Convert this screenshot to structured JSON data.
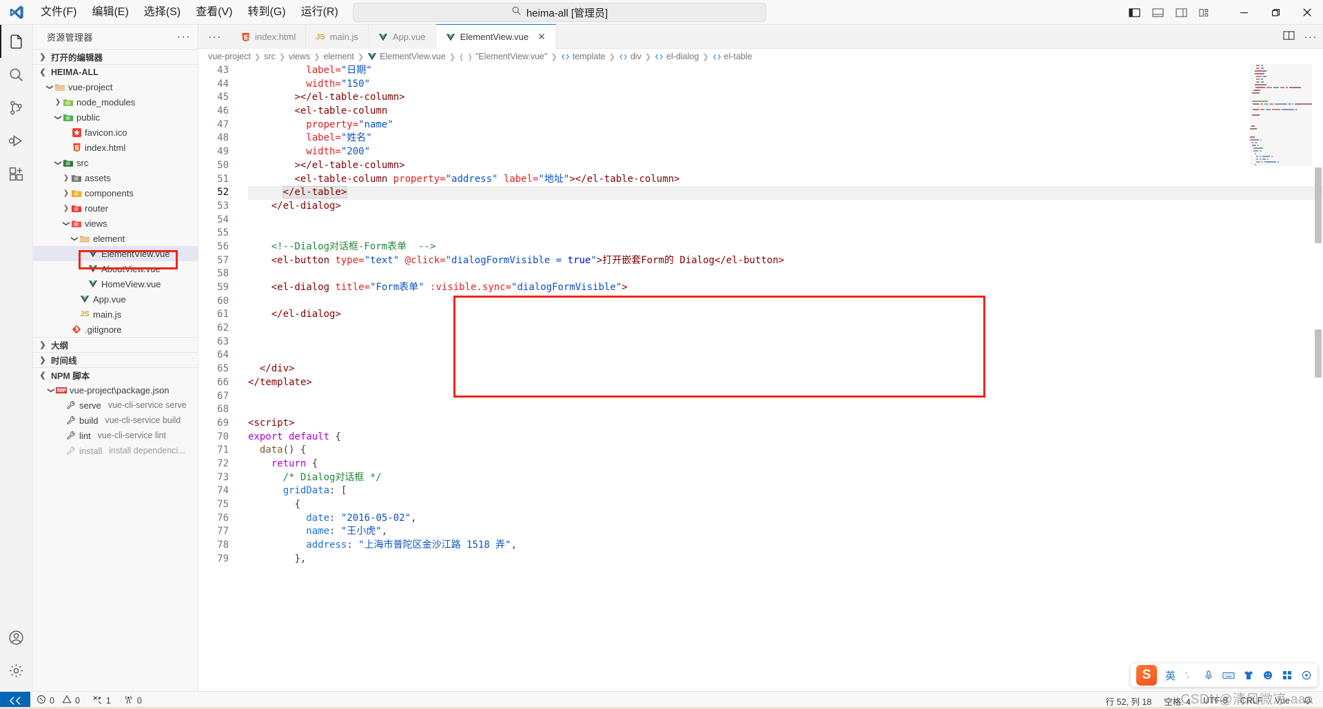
{
  "titlebar": {
    "logo_icon": "vscode-logo-icon",
    "menus": [
      "文件(F)",
      "编辑(E)",
      "选择(S)",
      "查看(V)",
      "转到(G)",
      "运行(R)"
    ],
    "more_label": "···",
    "nav_back_icon": "arrow-left-icon",
    "nav_forward_icon": "arrow-right-icon",
    "search": {
      "icon": "search-icon",
      "value": "heima-all [管理员]"
    },
    "layout_icons": [
      "toggle-primary-sidebar-icon",
      "toggle-panel-icon",
      "toggle-secondary-sidebar-icon",
      "customize-layout-icon"
    ],
    "window_controls": {
      "minimize": "minimize-icon",
      "maximize": "restore-icon",
      "close": "close-icon"
    }
  },
  "activitybar": {
    "items": [
      {
        "name": "explorer",
        "icon": "files-icon",
        "active": true
      },
      {
        "name": "search",
        "icon": "search-icon",
        "active": false
      },
      {
        "name": "source-control",
        "icon": "source-control-icon",
        "active": false
      },
      {
        "name": "run-debug",
        "icon": "debug-icon",
        "active": false
      },
      {
        "name": "extensions",
        "icon": "extensions-icon",
        "active": false
      }
    ],
    "bottom": [
      {
        "name": "accounts",
        "icon": "account-icon"
      },
      {
        "name": "settings",
        "icon": "gear-icon"
      }
    ]
  },
  "sidebar": {
    "title": "资源管理器",
    "more_actions": "···",
    "sections": [
      {
        "label": "打开的编辑器",
        "expanded": false
      },
      {
        "label": "HEIMA-ALL",
        "expanded": true
      },
      {
        "label": "大纲",
        "expanded": false
      },
      {
        "label": "时间线",
        "expanded": false
      },
      {
        "label": "NPM 脚本",
        "expanded": true
      }
    ],
    "tree": [
      {
        "label": "vue-project",
        "indent": 1,
        "twisty": "v",
        "icon": "folder-icon",
        "icon_color": "#dcb67a"
      },
      {
        "label": "node_modules",
        "indent": 2,
        "twisty": ">",
        "icon": "folder-node-icon",
        "icon_color": "#8bc34a"
      },
      {
        "label": "public",
        "indent": 2,
        "twisty": "v",
        "icon": "folder-public-icon",
        "icon_color": "#4caf50"
      },
      {
        "label": "favicon.ico",
        "indent": 3,
        "twisty": "",
        "icon": "favicon-icon",
        "icon_color": "#e8453c"
      },
      {
        "label": "index.html",
        "indent": 3,
        "twisty": "",
        "icon": "html5-icon",
        "icon_color": "#e44d26"
      },
      {
        "label": "src",
        "indent": 2,
        "twisty": "v",
        "icon": "folder-src-icon",
        "icon_color": "#2e7d32"
      },
      {
        "label": "assets",
        "indent": 3,
        "twisty": ">",
        "icon": "folder-assets-icon",
        "icon_color": "#757575"
      },
      {
        "label": "components",
        "indent": 3,
        "twisty": ">",
        "icon": "folder-components-icon",
        "icon_color": "#f9a825"
      },
      {
        "label": "router",
        "indent": 3,
        "twisty": ">",
        "icon": "folder-router-icon",
        "icon_color": "#e53935"
      },
      {
        "label": "views",
        "indent": 3,
        "twisty": "v",
        "icon": "folder-views-icon",
        "icon_color": "#ef5350"
      },
      {
        "label": "element",
        "indent": 4,
        "twisty": "v",
        "icon": "folder-icon",
        "icon_color": "#dcb67a"
      },
      {
        "label": "ElementView.vue",
        "indent": 5,
        "twisty": "",
        "icon": "vue-icon",
        "icon_color": "#41b883",
        "selected": true,
        "highlighted": true
      },
      {
        "label": "AboutView.vue",
        "indent": 5,
        "twisty": "",
        "icon": "vue-icon",
        "icon_color": "#41b883"
      },
      {
        "label": "HomeView.vue",
        "indent": 5,
        "twisty": "",
        "icon": "vue-icon",
        "icon_color": "#41b883"
      },
      {
        "label": "App.vue",
        "indent": 4,
        "twisty": "",
        "icon": "vue-icon",
        "icon_color": "#41b883"
      },
      {
        "label": "main.js",
        "indent": 4,
        "twisty": "",
        "icon": "js-icon",
        "icon_color": "#f5c542"
      },
      {
        "label": ".gitignore",
        "indent": 3,
        "twisty": "",
        "icon": "git-icon",
        "icon_color": "#e8453c"
      }
    ],
    "npm_scripts": [
      {
        "label": "vue-project\\package.json",
        "indent": 1,
        "twisty": "v",
        "icon": "npm-icon",
        "sub": ""
      },
      {
        "label": "serve",
        "indent": 2,
        "twisty": "",
        "icon": "wrench-icon",
        "sub": "vue-cli-service serve"
      },
      {
        "label": "build",
        "indent": 2,
        "twisty": "",
        "icon": "wrench-icon",
        "sub": "vue-cli-service build"
      },
      {
        "label": "lint",
        "indent": 2,
        "twisty": "",
        "icon": "wrench-icon",
        "sub": "vue-cli-service lint"
      },
      {
        "label": "install",
        "indent": 2,
        "twisty": "",
        "icon": "wrench-icon",
        "sub": "install dependenci...",
        "dim": true
      }
    ]
  },
  "editor": {
    "tabs_more_icon": "···",
    "tabs": [
      {
        "label": "index.html",
        "icon": "html5-icon",
        "icon_color": "#e44d26",
        "active": false,
        "dirty": false
      },
      {
        "label": "main.js",
        "icon": "js-icon",
        "icon_color": "#f5c542",
        "active": false,
        "dirty": false
      },
      {
        "label": "App.vue",
        "icon": "vue-icon",
        "icon_color": "#41b883",
        "active": false,
        "dirty": false
      },
      {
        "label": "ElementView.vue",
        "icon": "vue-icon",
        "icon_color": "#41b883",
        "active": true,
        "dirty": false,
        "close_icon": "close-icon"
      }
    ],
    "tab_actions": [
      "split-editor-icon",
      "more-actions-icon"
    ],
    "breadcrumb": [
      {
        "label": "vue-project",
        "icon": ""
      },
      {
        "label": "src",
        "icon": ""
      },
      {
        "label": "views",
        "icon": ""
      },
      {
        "label": "element",
        "icon": ""
      },
      {
        "label": "ElementView.vue",
        "icon": "vue-icon"
      },
      {
        "label": "\"ElementView.vue\"",
        "icon": "braces-icon"
      },
      {
        "label": "template",
        "icon": "tag-icon"
      },
      {
        "label": "div",
        "icon": "tag-icon"
      },
      {
        "label": "el-dialog",
        "icon": "tag-icon"
      },
      {
        "label": "el-table",
        "icon": "tag-icon"
      }
    ],
    "first_line_number": 43,
    "lines": [
      {
        "n": 43,
        "tokens": [
          {
            "t": "          ",
            "c": "plain"
          },
          {
            "t": "label=",
            "c": "attr"
          },
          {
            "t": "\"日期\"",
            "c": "str"
          }
        ]
      },
      {
        "n": 44,
        "tokens": [
          {
            "t": "          ",
            "c": "plain"
          },
          {
            "t": "width=",
            "c": "attr"
          },
          {
            "t": "\"150\"",
            "c": "str"
          }
        ]
      },
      {
        "n": 45,
        "tokens": [
          {
            "t": "        ",
            "c": "plain"
          },
          {
            "t": "></el-table-column>",
            "c": "tag"
          }
        ]
      },
      {
        "n": 46,
        "tokens": [
          {
            "t": "        ",
            "c": "plain"
          },
          {
            "t": "<el-table-column",
            "c": "tag"
          }
        ]
      },
      {
        "n": 47,
        "tokens": [
          {
            "t": "          ",
            "c": "plain"
          },
          {
            "t": "property=",
            "c": "attr"
          },
          {
            "t": "\"name\"",
            "c": "str"
          }
        ]
      },
      {
        "n": 48,
        "tokens": [
          {
            "t": "          ",
            "c": "plain"
          },
          {
            "t": "label=",
            "c": "attr"
          },
          {
            "t": "\"姓名\"",
            "c": "str"
          }
        ]
      },
      {
        "n": 49,
        "tokens": [
          {
            "t": "          ",
            "c": "plain"
          },
          {
            "t": "width=",
            "c": "attr"
          },
          {
            "t": "\"200\"",
            "c": "str"
          }
        ]
      },
      {
        "n": 50,
        "tokens": [
          {
            "t": "        ",
            "c": "plain"
          },
          {
            "t": "></el-table-column>",
            "c": "tag"
          }
        ]
      },
      {
        "n": 51,
        "tokens": [
          {
            "t": "        ",
            "c": "plain"
          },
          {
            "t": "<el-table-column ",
            "c": "tag"
          },
          {
            "t": "property=",
            "c": "attr"
          },
          {
            "t": "\"address\"",
            "c": "str"
          },
          {
            "t": " ",
            "c": "plain"
          },
          {
            "t": "label=",
            "c": "attr"
          },
          {
            "t": "\"地址\"",
            "c": "str"
          },
          {
            "t": "></el-table-column>",
            "c": "tag"
          }
        ]
      },
      {
        "n": 52,
        "current": true,
        "tokens": [
          {
            "t": "      ",
            "c": "plain"
          },
          {
            "t": "</el-table>",
            "c": "tag",
            "sel": true
          }
        ]
      },
      {
        "n": 53,
        "tokens": [
          {
            "t": "    ",
            "c": "plain"
          },
          {
            "t": "</el-dialog>",
            "c": "tag"
          }
        ]
      },
      {
        "n": 54,
        "tokens": []
      },
      {
        "n": 55,
        "tokens": []
      },
      {
        "n": 56,
        "tokens": [
          {
            "t": "    ",
            "c": "plain"
          },
          {
            "t": "<!--Dialog对话框-Form表单  -->",
            "c": "cmt"
          }
        ]
      },
      {
        "n": 57,
        "tokens": [
          {
            "t": "    ",
            "c": "plain"
          },
          {
            "t": "<el-button ",
            "c": "tag"
          },
          {
            "t": "type=",
            "c": "attr"
          },
          {
            "t": "\"text\"",
            "c": "str"
          },
          {
            "t": " ",
            "c": "plain"
          },
          {
            "t": "@click=",
            "c": "attr"
          },
          {
            "t": "\"dialogFormVisible = ",
            "c": "str"
          },
          {
            "t": "true",
            "c": "kw"
          },
          {
            "t": "\"",
            "c": "str"
          },
          {
            "t": ">打开嵌套Form的 Dialog</el-button>",
            "c": "tag"
          }
        ]
      },
      {
        "n": 58,
        "tokens": []
      },
      {
        "n": 59,
        "tokens": [
          {
            "t": "    ",
            "c": "plain"
          },
          {
            "t": "<el-dialog ",
            "c": "tag"
          },
          {
            "t": "title=",
            "c": "attr"
          },
          {
            "t": "\"Form表单\"",
            "c": "str"
          },
          {
            "t": " ",
            "c": "plain"
          },
          {
            "t": ":visible.sync=",
            "c": "attr"
          },
          {
            "t": "\"dialogFormVisible\"",
            "c": "str"
          },
          {
            "t": ">",
            "c": "tag"
          }
        ]
      },
      {
        "n": 60,
        "tokens": []
      },
      {
        "n": 61,
        "tokens": [
          {
            "t": "    ",
            "c": "plain"
          },
          {
            "t": "</el-dialog>",
            "c": "tag"
          }
        ]
      },
      {
        "n": 62,
        "tokens": []
      },
      {
        "n": 63,
        "tokens": []
      },
      {
        "n": 64,
        "tokens": []
      },
      {
        "n": 65,
        "tokens": [
          {
            "t": "  ",
            "c": "plain"
          },
          {
            "t": "</div>",
            "c": "tag"
          }
        ]
      },
      {
        "n": 66,
        "tokens": [
          {
            "t": "</template>",
            "c": "tag"
          }
        ]
      },
      {
        "n": 67,
        "tokens": []
      },
      {
        "n": 68,
        "tokens": []
      },
      {
        "n": 69,
        "tokens": [
          {
            "t": "<script>",
            "c": "tag"
          }
        ]
      },
      {
        "n": 70,
        "tokens": [
          {
            "t": "export default",
            "c": "kw2"
          },
          {
            "t": " {",
            "c": "punc"
          }
        ]
      },
      {
        "n": 71,
        "tokens": [
          {
            "t": "  ",
            "c": "plain"
          },
          {
            "t": "data",
            "c": "fn"
          },
          {
            "t": "() {",
            "c": "punc"
          }
        ]
      },
      {
        "n": 72,
        "tokens": [
          {
            "t": "    ",
            "c": "plain"
          },
          {
            "t": "return",
            "c": "kw2"
          },
          {
            "t": " {",
            "c": "punc"
          }
        ]
      },
      {
        "n": 73,
        "tokens": [
          {
            "t": "      ",
            "c": "plain"
          },
          {
            "t": "/* Dialog对话框 */",
            "c": "cmt"
          }
        ]
      },
      {
        "n": 74,
        "tokens": [
          {
            "t": "      ",
            "c": "plain"
          },
          {
            "t": "gridData",
            "c": "prop"
          },
          {
            "t": ": [",
            "c": "punc"
          }
        ]
      },
      {
        "n": 75,
        "tokens": [
          {
            "t": "        ",
            "c": "plain"
          },
          {
            "t": "{",
            "c": "punc"
          }
        ]
      },
      {
        "n": 76,
        "tokens": [
          {
            "t": "          ",
            "c": "plain"
          },
          {
            "t": "date",
            "c": "prop"
          },
          {
            "t": ": ",
            "c": "punc"
          },
          {
            "t": "\"2016-05-02\"",
            "c": "str"
          },
          {
            "t": ",",
            "c": "punc"
          }
        ]
      },
      {
        "n": 77,
        "tokens": [
          {
            "t": "          ",
            "c": "plain"
          },
          {
            "t": "name",
            "c": "prop"
          },
          {
            "t": ": ",
            "c": "punc"
          },
          {
            "t": "\"王小虎\"",
            "c": "str"
          },
          {
            "t": ",",
            "c": "punc"
          }
        ]
      },
      {
        "n": 78,
        "tokens": [
          {
            "t": "          ",
            "c": "plain"
          },
          {
            "t": "address",
            "c": "prop"
          },
          {
            "t": ": ",
            "c": "punc"
          },
          {
            "t": "\"上海市普陀区金沙江路 1518 弄\"",
            "c": "str"
          },
          {
            "t": ",",
            "c": "punc"
          }
        ]
      },
      {
        "n": 79,
        "tokens": [
          {
            "t": "        ",
            "c": "plain"
          },
          {
            "t": "},",
            "c": "punc"
          }
        ]
      }
    ],
    "annotation_boxes": [
      {
        "name": "code-highlight-rect",
        "color": "#f02417"
      },
      {
        "name": "sidebar-highlight-rect",
        "color": "#f02417"
      }
    ]
  },
  "statusbar": {
    "remote_icon": "remote-icon",
    "errors": {
      "icon": "error-icon",
      "count": "0"
    },
    "warnings": {
      "icon": "warning-icon",
      "count": "0"
    },
    "ports": {
      "icon": "tools-icon",
      "count": "1"
    },
    "radio": {
      "icon": "radio-tower-icon",
      "count": "0"
    },
    "cursor_position": "行 52, 列 18",
    "indentation": "空格: 4",
    "encoding": "UTF-8",
    "eol": "CRLF",
    "language": "Vue",
    "bell_icon": "bell-icon"
  },
  "ime": {
    "logo": "S",
    "mode": "英",
    "items": [
      "punctuation-icon",
      "microphone-icon",
      "keyboard-icon",
      "shirt-icon",
      "emoji-icon",
      "apps-icon",
      "settings-icon"
    ]
  },
  "watermark": "CSDN@清风微凉 aaa",
  "colors": {
    "accent": "#0078d4",
    "highlight_rect": "#f02417",
    "selection": "#e4e6f1",
    "remote_bg": "#0066b8",
    "vue_green": "#41b883",
    "comment_green": "#22863a",
    "tag_maroon": "#800000",
    "attr_red": "#e02020",
    "string_blue": "#0b51c5"
  }
}
